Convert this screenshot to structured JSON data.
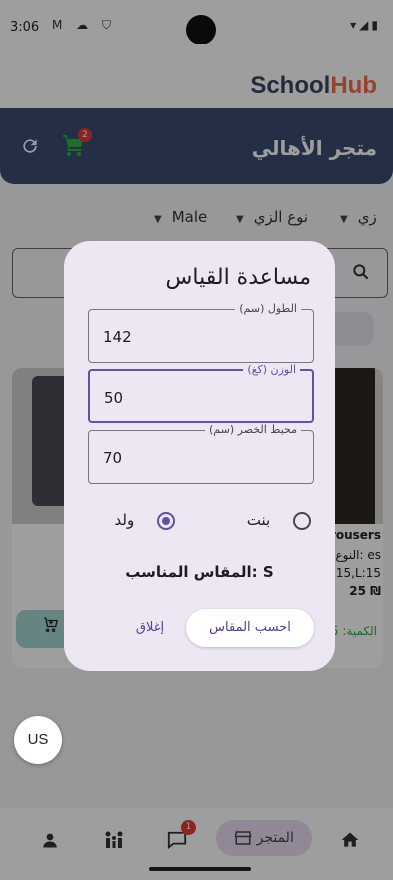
{
  "status_bar": {
    "time": "3:06",
    "left_icons": "M ☁ ⛉",
    "right_icons": "▾◢▮"
  },
  "brand": {
    "part1": "School",
    "part2": "Hub"
  },
  "header": {
    "title": "متجر الأهالي",
    "cart_badge": "2"
  },
  "filters": {
    "gender": "Male",
    "uniform_type": "نوع الزي",
    "third": "زي"
  },
  "chip": {
    "label": "مـ"
  },
  "cards": {
    "left": {
      "line1": ":ـ"
    },
    "right": {
      "name": "Trousers",
      "type_line": "النوع: es",
      "sizes_line": "L:15,L:15",
      "price": "25 ₪",
      "qty": "الكمية: 5"
    }
  },
  "fab": {
    "label": "US"
  },
  "bottom_nav": {
    "store_label": "المتجر",
    "chat_badge": "1"
  },
  "dialog": {
    "title": "مساعدة القياس",
    "fields": [
      {
        "label": "الطول (سم)",
        "value": "142"
      },
      {
        "label": "الوزن (كغ)",
        "value": "50"
      },
      {
        "label": "محيط الخصر (سم)",
        "value": "70"
      }
    ],
    "radio_boy": "ولد",
    "radio_girl": "بنت",
    "selected": "boy",
    "result": "S :المقاس المناسب",
    "calc_button": "احسب المقاس",
    "close_button": "إغلاق"
  }
}
